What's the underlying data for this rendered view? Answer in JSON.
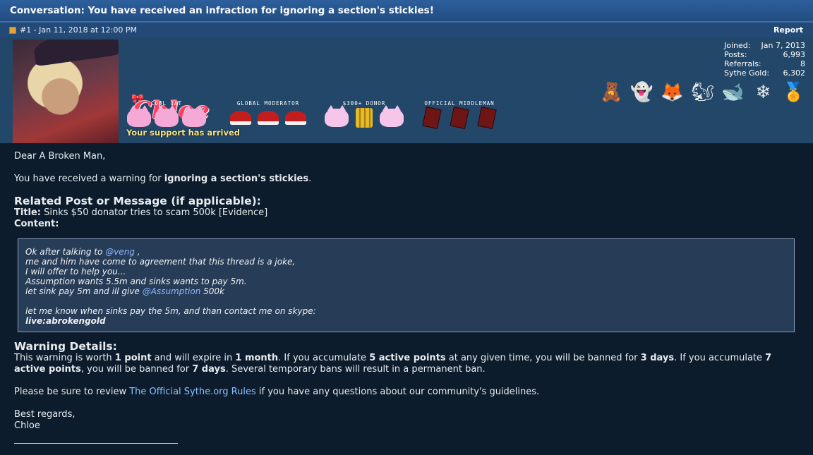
{
  "conversation": {
    "title": "Conversation: You have received an infraction for ignoring a section's stickies!"
  },
  "post": {
    "meta": "#1 - Jan 11, 2018 at 12:00 PM",
    "report_label": "Report"
  },
  "user": {
    "name": "Chloe",
    "title": "Your support has arrived",
    "badges": [
      {
        "label": "COOL CAT"
      },
      {
        "label": "GLOBAL MODERATOR"
      },
      {
        "label": "$300+ DONOR"
      },
      {
        "label": "OFFICIAL MIDDLEMAN"
      }
    ],
    "stats": [
      {
        "key": "Joined:",
        "value": "Jan 7, 2013"
      },
      {
        "key": "Posts:",
        "value": "6,993"
      },
      {
        "key": "Referrals:",
        "value": "8"
      },
      {
        "key": "Sythe Gold:",
        "value": "6,302"
      }
    ],
    "pets": [
      "bear-icon",
      "ghost-icon",
      "fox-icon",
      "squirrel-icon",
      "whale-icon",
      "snowflake-icon",
      "medal-icon"
    ]
  },
  "message": {
    "greeting": "Dear A Broken Man,",
    "warning_prefix": "You have received a warning for ",
    "warning_reason": "ignoring a section's stickies",
    "warning_suffix": ".",
    "related_heading": "Related Post or Message (if applicable):",
    "title_label": "Title:",
    "title_value": " Sinks $50 donator tries to scam 500k [Evidence]",
    "content_label": "Content:",
    "quote": {
      "line1_prefix": "Ok after talking to ",
      "line1_mention": "@veng",
      "line1_suffix": " ,",
      "line2": "me and him have come to agreement that this thread is a joke,",
      "line3": "I will offer to help you...",
      "line4": "Assumption wants 5.5m and sinks wants to pay 5m.",
      "line5_prefix": "let sink pay 5m and ill give ",
      "line5_mention": "@Assumption",
      "line5_suffix": " 500k",
      "line6": "let me know when sinks pay the 5m, and than contact me on skype:",
      "line7": "live:abrokengold"
    },
    "details_heading": "Warning Details:",
    "details": {
      "t1": "This warning is worth ",
      "b1": "1 point",
      "t2": " and will expire in ",
      "b2": "1 month",
      "t3": ". If you accumulate ",
      "b3": "5 active points",
      "t4": " at any given time, you will be banned for ",
      "b4": "3 days",
      "t5": ". If you accumulate ",
      "b5": "7 active points",
      "t6": ", you will be banned for ",
      "b6": "7 days",
      "t7": ". Several temporary bans will result in a permanent ban."
    },
    "review_prefix": "Please be sure to review ",
    "review_link": "The Official Sythe.org Rules",
    "review_suffix": " if you have any questions about our community's guidelines.",
    "closing": "Best regards,",
    "signature": "Chloe"
  }
}
